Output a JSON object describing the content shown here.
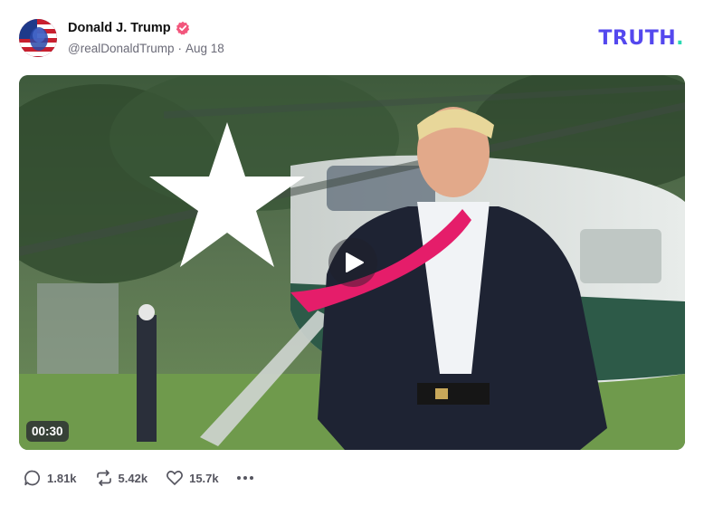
{
  "post": {
    "author_name": "Donald J. Trump",
    "handle": "@realDonaldTrump",
    "separator": "·",
    "date": "Aug 18",
    "verified_icon": "verified-badge-icon",
    "verified_color": "#f2567c"
  },
  "brand": {
    "logo_text": "TRUTH",
    "logo_dot": ".",
    "logo_color": "#5448ee",
    "logo_dot_color": "#2bd9b3"
  },
  "video": {
    "duration": "00:30",
    "play_icon": "play-icon"
  },
  "actions": {
    "replies": "1.81k",
    "retruths": "5.42k",
    "likes": "15.7k",
    "reply_icon": "comment-icon",
    "retruth_icon": "repost-icon",
    "like_icon": "heart-icon",
    "more_icon": "more-horizontal-icon"
  }
}
